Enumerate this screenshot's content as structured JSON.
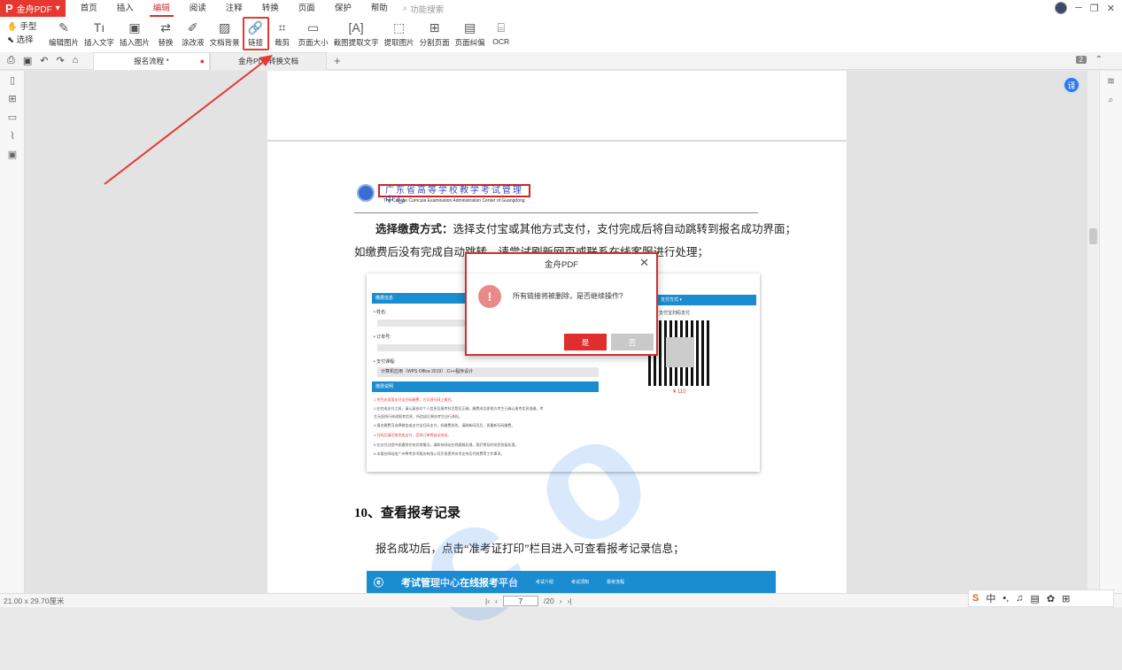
{
  "app": {
    "brand": "金舟PDF"
  },
  "menu": {
    "items": [
      "首页",
      "插入",
      "编辑",
      "阅读",
      "注释",
      "转换",
      "页面",
      "保护",
      "帮助"
    ],
    "search": "功能搜索"
  },
  "toolleft": {
    "hand": "手型",
    "select": "选择"
  },
  "tools": [
    "编辑图片",
    "插入文字",
    "插入图片",
    "替换",
    "涂改液",
    "文档背景",
    "链接",
    "裁剪",
    "页面大小",
    "截图提取文字",
    "提取图片",
    "分割页面",
    "页面纠偏",
    "OCR"
  ],
  "tabs": {
    "active": "报名流程 *",
    "inactive": "金舟PDF转换文档"
  },
  "page_badge": "2",
  "doc": {
    "logo_title": "广东省高等学校教学考试管理中心",
    "logo_sub": "The College Curricula Examination Administration Center of Guangdong",
    "para1_bold": "选择缴费方式：",
    "para1_rest": "选择支付宝或其他方式支付，支付完成后将自动跳转到报名成功界面；",
    "para2": "如缴费后没有完成自动跳转，请尝试刷新网页或联系在线客服进行处理；",
    "heading": "10、查看报考记录",
    "para3": "报名成功后，点击“准考证打印”栏目进入可查看报考记录信息；",
    "shot": {
      "bar1": "缴费信息",
      "name_label": "• 姓名:",
      "order_label": "• 订单号:",
      "course_label": "• 支付课程:",
      "course_value": "计算机应用（WPS Office 2019）.C++程序设计",
      "bar2": "缴费说明",
      "notes": [
        "1.考生必须用支付宝扫码缴费，方可进行网上报名。",
        "2.在完成支付之前，请认真核对个人信息及报考科目是否正确，缴费成功即视为考生已确认报考信息准确，考",
        "生无权再行修改报考信息，所造成后果由考生自行承担。",
        "3.报名缴费可选择微信或支付宝扫码支付，如缴费失败，请刷新网页后，再重新扫码缴费。",
        "4.扫码后请尽快完成支付，否则订单将自动关闭。",
        "5.在支付过程中如遇到任何异常情况，请联系网站在线客服处理，我们将及时给您答复处理。",
        "6.本报名网站由广州粤考技术服务有限公司负责提供技术支持及代收费等工作事项。"
      ],
      "pay_bar": "支付方式 ▾",
      "pay_hint": "支付宝扫码支付",
      "price": "¥ 110"
    },
    "shot2": {
      "title": "考试管理中心在线报考平台",
      "nav": [
        "考试介绍",
        "考试须知",
        "报考流程"
      ]
    }
  },
  "dialog": {
    "title": "金舟PDF",
    "message": "所有链接将被删除，是否继续操作?",
    "yes": "是",
    "no": "否"
  },
  "status": {
    "dimensions": "21.00 x 29.70厘米",
    "current_page": "7",
    "total_pages": "/20"
  },
  "ime": {
    "lang": "中"
  },
  "colors": {
    "brand_red": "#e8372f",
    "accent_blue": "#1a8dd1",
    "arrow_red": "#e53935"
  }
}
